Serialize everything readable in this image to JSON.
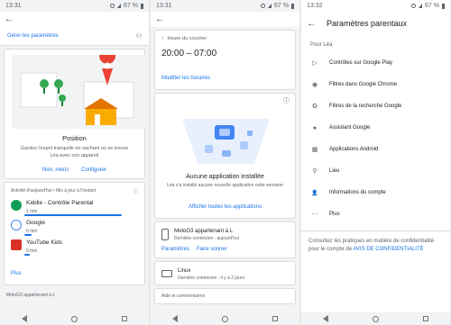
{
  "panel1": {
    "status_time": "13:31",
    "status_battery": "67 %",
    "manage_settings": "Gérer les paramètres",
    "location_title": "Position",
    "location_desc": "Gardez l'esprit tranquille en sachant où se trouve Léa avec son appareil",
    "no_thanks": "Non, merci",
    "configure": "Configurer",
    "activity_header": "Activité d'aujourd'hui • Mis à jour à l'instant",
    "apps": [
      {
        "name": "Kiddie - Contrôle Parental",
        "time": "1 min",
        "color": "#0f9d58"
      },
      {
        "name": "Google",
        "time": "0 min",
        "color": "#4285f4"
      },
      {
        "name": "YouTube Kids",
        "time": "0 min",
        "color": "#d93025"
      }
    ],
    "more": "Plus",
    "footer": "MotoG3 appartenant à L"
  },
  "panel2": {
    "status_time": "13:31",
    "status_battery": "67 %",
    "bedtime_label": "Heure du coucher",
    "bedtime_value": "20:00 – 07:00",
    "edit_hours": "Modifier les horaires",
    "no_app_title": "Aucune application installée",
    "no_app_desc": "Léa n'a installé aucune nouvelle application cette semaine",
    "show_all": "Afficher toutes les applications",
    "device1_name": "MotoG3 appartenant à L",
    "device1_sub": "Dernière connexion : aujourd'hui",
    "settings": "Paramètres",
    "ring": "Faire sonner",
    "device2_name": "Linux",
    "device2_sub": "Dernière connexion : il y a 2 jours",
    "help": "Aide et commentaires"
  },
  "panel3": {
    "status_time": "13:32",
    "status_battery": "67 %",
    "title": "Paramètres parentaux",
    "section": "Pour Léa",
    "items": [
      {
        "label": "Contrôles sur Google Play",
        "icon": "play-icon",
        "glyph": "▷"
      },
      {
        "label": "Filtres dans Google Chrome",
        "icon": "chrome-icon",
        "glyph": "◉"
      },
      {
        "label": "Filtres de la recherche Google",
        "icon": "google-icon",
        "glyph": "G"
      },
      {
        "label": "Assistant Google",
        "icon": "assistant-icon",
        "glyph": "●"
      },
      {
        "label": "Applications Android",
        "icon": "android-apps-icon",
        "glyph": "▦"
      },
      {
        "label": "Lieu",
        "icon": "location-pin-icon",
        "glyph": "⚲"
      },
      {
        "label": "Informations du compte",
        "icon": "person-icon",
        "glyph": "👤"
      },
      {
        "label": "Plus",
        "icon": "more-icon",
        "glyph": "⋯"
      }
    ],
    "footer_text": "Consultez les pratiques en matière de confidentialité pour le compte de",
    "privacy_link": "AVIS DE CONFIDENTIALITÉ"
  }
}
